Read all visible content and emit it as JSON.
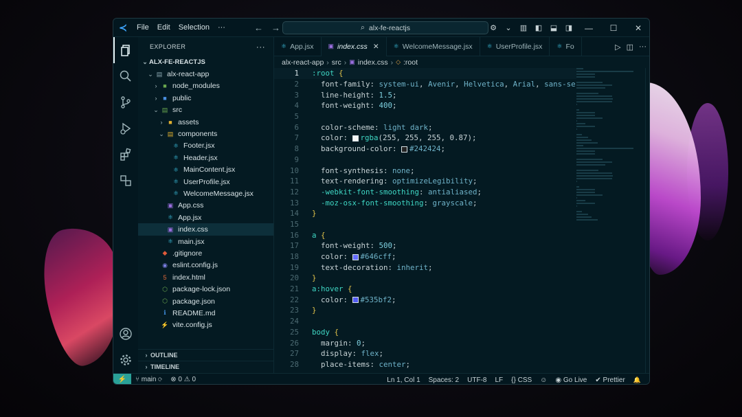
{
  "window": {
    "menu": [
      "File",
      "Edit",
      "Selection",
      "···"
    ],
    "search_text": "alx-fe-reactjs"
  },
  "sidebar": {
    "title": "EXPLORER",
    "more": "···",
    "workspace": "ALX-FE-REACTJS",
    "tree": [
      {
        "label": "alx-react-app",
        "depth": 1,
        "twisty": "open",
        "icon": "folder-open-icon",
        "icon_char": "▤",
        "color": "#8aa6b0"
      },
      {
        "label": "node_modules",
        "depth": 2,
        "twisty": "closed",
        "icon": "folder-node-icon",
        "icon_char": "■",
        "color": "#6aa84f"
      },
      {
        "label": "public",
        "depth": 2,
        "twisty": "closed",
        "icon": "folder-public-icon",
        "icon_char": "■",
        "color": "#4a8fe0"
      },
      {
        "label": "src",
        "depth": 2,
        "twisty": "open",
        "icon": "folder-src-icon",
        "icon_char": "▤",
        "color": "#6aa84f"
      },
      {
        "label": "assets",
        "depth": 3,
        "twisty": "closed",
        "icon": "folder-assets-icon",
        "icon_char": "■",
        "color": "#e0b030"
      },
      {
        "label": "components",
        "depth": 3,
        "twisty": "open",
        "icon": "folder-components-icon",
        "icon_char": "▤",
        "color": "#e0b030"
      },
      {
        "label": "Footer.jsx",
        "depth": 4,
        "twisty": "",
        "icon": "react-icon",
        "icon_char": "⚛",
        "color": "#3fc8e8"
      },
      {
        "label": "Header.jsx",
        "depth": 4,
        "twisty": "",
        "icon": "react-icon",
        "icon_char": "⚛",
        "color": "#3fc8e8"
      },
      {
        "label": "MainContent.jsx",
        "depth": 4,
        "twisty": "",
        "icon": "react-icon",
        "icon_char": "⚛",
        "color": "#3fc8e8"
      },
      {
        "label": "UserProfile.jsx",
        "depth": 4,
        "twisty": "",
        "icon": "react-icon",
        "icon_char": "⚛",
        "color": "#3fc8e8"
      },
      {
        "label": "WelcomeMessage.jsx",
        "depth": 4,
        "twisty": "",
        "icon": "react-icon",
        "icon_char": "⚛",
        "color": "#3fc8e8"
      },
      {
        "label": "App.css",
        "depth": 3,
        "twisty": "",
        "icon": "css-icon",
        "icon_char": "▣",
        "color": "#9b6fe0"
      },
      {
        "label": "App.jsx",
        "depth": 3,
        "twisty": "",
        "icon": "react-icon",
        "icon_char": "⚛",
        "color": "#3fc8e8"
      },
      {
        "label": "index.css",
        "depth": 3,
        "twisty": "",
        "icon": "css-icon",
        "icon_char": "▣",
        "color": "#9b6fe0",
        "selected": true
      },
      {
        "label": "main.jsx",
        "depth": 3,
        "twisty": "",
        "icon": "react-icon",
        "icon_char": "⚛",
        "color": "#3fc8e8"
      },
      {
        "label": ".gitignore",
        "depth": 2,
        "twisty": "",
        "icon": "git-icon",
        "icon_char": "◆",
        "color": "#e05a3a"
      },
      {
        "label": "eslint.config.js",
        "depth": 2,
        "twisty": "",
        "icon": "eslint-icon",
        "icon_char": "◉",
        "color": "#7a7ee0"
      },
      {
        "label": "index.html",
        "depth": 2,
        "twisty": "",
        "icon": "html-icon",
        "icon_char": "5",
        "color": "#e06a3a"
      },
      {
        "label": "package-lock.json",
        "depth": 2,
        "twisty": "",
        "icon": "nodejs-icon",
        "icon_char": "⬡",
        "color": "#6aa84f"
      },
      {
        "label": "package.json",
        "depth": 2,
        "twisty": "",
        "icon": "nodejs-icon",
        "icon_char": "⬡",
        "color": "#6aa84f"
      },
      {
        "label": "README.md",
        "depth": 2,
        "twisty": "",
        "icon": "info-icon",
        "icon_char": "ℹ",
        "color": "#3f8fe0"
      },
      {
        "label": "vite.config.js",
        "depth": 2,
        "twisty": "",
        "icon": "vite-icon",
        "icon_char": "⚡",
        "color": "#e0c030"
      }
    ],
    "outline": "OUTLINE",
    "timeline": "TIMELINE"
  },
  "tabs": [
    {
      "label": "App.jsx",
      "icon": "react-icon",
      "icon_char": "⚛",
      "color": "#3fc8e8"
    },
    {
      "label": "index.css",
      "icon": "css-icon",
      "icon_char": "▣",
      "color": "#9b6fe0",
      "active": true,
      "close": "✕"
    },
    {
      "label": "WelcomeMessage.jsx",
      "icon": "react-icon",
      "icon_char": "⚛",
      "color": "#3fc8e8"
    },
    {
      "label": "UserProfile.jsx",
      "icon": "react-icon",
      "icon_char": "⚛",
      "color": "#3fc8e8"
    },
    {
      "label": "Fo",
      "icon": "react-icon",
      "icon_char": "⚛",
      "color": "#3fc8e8"
    }
  ],
  "breadcrumb": [
    "alx-react-app",
    "src",
    "index.css",
    ":root"
  ],
  "editor": {
    "current_line": 1,
    "lines": [
      [
        {
          "t": ":root",
          "c": "sel"
        },
        {
          "t": " "
        },
        {
          "t": "{",
          "c": "br"
        }
      ],
      [
        {
          "t": "  font-family",
          "c": "prop"
        },
        {
          "t": ": "
        },
        {
          "t": "system-ui",
          "c": "val"
        },
        {
          "t": ", "
        },
        {
          "t": "Avenir",
          "c": "val"
        },
        {
          "t": ", "
        },
        {
          "t": "Helvetica",
          "c": "val"
        },
        {
          "t": ", "
        },
        {
          "t": "Arial",
          "c": "val"
        },
        {
          "t": ", "
        },
        {
          "t": "sans-se",
          "c": "val"
        }
      ],
      [
        {
          "t": "  line-height",
          "c": "prop"
        },
        {
          "t": ": "
        },
        {
          "t": "1.5",
          "c": "num"
        },
        {
          "t": ";"
        }
      ],
      [
        {
          "t": "  font-weight",
          "c": "prop"
        },
        {
          "t": ": "
        },
        {
          "t": "400",
          "c": "num"
        },
        {
          "t": ";"
        }
      ],
      [],
      [
        {
          "t": "  color-scheme",
          "c": "prop"
        },
        {
          "t": ": "
        },
        {
          "t": "light dark",
          "c": "val"
        },
        {
          "t": ";"
        }
      ],
      [
        {
          "t": "  color",
          "c": "prop"
        },
        {
          "t": ": "
        },
        {
          "sw": "#f5f5f5"
        },
        {
          "t": "rgba",
          "c": "fn"
        },
        {
          "t": "(255, 255, 255, 0.87);"
        }
      ],
      [
        {
          "t": "  background-color",
          "c": "prop"
        },
        {
          "t": ": "
        },
        {
          "sw": "#242424"
        },
        {
          "t": "#242424",
          "c": "val"
        },
        {
          "t": ";"
        }
      ],
      [],
      [
        {
          "t": "  font-synthesis",
          "c": "prop"
        },
        {
          "t": ": "
        },
        {
          "t": "none",
          "c": "val"
        },
        {
          "t": ";"
        }
      ],
      [
        {
          "t": "  text-rendering",
          "c": "prop"
        },
        {
          "t": ": "
        },
        {
          "t": "optimizeLegibility",
          "c": "val"
        },
        {
          "t": ";"
        }
      ],
      [
        {
          "t": "  -webkit-font-smoothing",
          "c": "vendor"
        },
        {
          "t": ": "
        },
        {
          "t": "antialiased",
          "c": "val"
        },
        {
          "t": ";"
        }
      ],
      [
        {
          "t": "  -moz-osx-font-smoothing",
          "c": "vendor"
        },
        {
          "t": ": "
        },
        {
          "t": "grayscale",
          "c": "val"
        },
        {
          "t": ";"
        }
      ],
      [
        {
          "t": "}",
          "c": "br"
        }
      ],
      [],
      [
        {
          "t": "a",
          "c": "sel"
        },
        {
          "t": " "
        },
        {
          "t": "{",
          "c": "br"
        }
      ],
      [
        {
          "t": "  font-weight",
          "c": "prop"
        },
        {
          "t": ": "
        },
        {
          "t": "500",
          "c": "num"
        },
        {
          "t": ";"
        }
      ],
      [
        {
          "t": "  color",
          "c": "prop"
        },
        {
          "t": ": "
        },
        {
          "sw": "#646cff"
        },
        {
          "t": "#646cff",
          "c": "val"
        },
        {
          "t": ";"
        }
      ],
      [
        {
          "t": "  text-decoration",
          "c": "prop"
        },
        {
          "t": ": "
        },
        {
          "t": "inherit",
          "c": "val"
        },
        {
          "t": ";"
        }
      ],
      [
        {
          "t": "}",
          "c": "br"
        }
      ],
      [
        {
          "t": "a:hover",
          "c": "sel"
        },
        {
          "t": " "
        },
        {
          "t": "{",
          "c": "br"
        }
      ],
      [
        {
          "t": "  color",
          "c": "prop"
        },
        {
          "t": ": "
        },
        {
          "sw": "#535bf2"
        },
        {
          "t": "#535bf2",
          "c": "val"
        },
        {
          "t": ";"
        }
      ],
      [
        {
          "t": "}",
          "c": "br"
        }
      ],
      [],
      [
        {
          "t": "body",
          "c": "sel"
        },
        {
          "t": " "
        },
        {
          "t": "{",
          "c": "br"
        }
      ],
      [
        {
          "t": "  margin",
          "c": "prop"
        },
        {
          "t": ": "
        },
        {
          "t": "0",
          "c": "num"
        },
        {
          "t": ";"
        }
      ],
      [
        {
          "t": "  display",
          "c": "prop"
        },
        {
          "t": ": "
        },
        {
          "t": "flex",
          "c": "val"
        },
        {
          "t": ";"
        }
      ],
      [
        {
          "t": "  place-items",
          "c": "prop"
        },
        {
          "t": ": "
        },
        {
          "t": "center",
          "c": "val"
        },
        {
          "t": ";"
        }
      ]
    ]
  },
  "status": {
    "remote_icon": "⚡",
    "branch": "main",
    "sync_icon": "⟳",
    "problems": "⊗ 0 ⚠ 0",
    "position": "Ln 1, Col 1",
    "spaces": "Spaces: 2",
    "encoding": "UTF-8",
    "eol": "LF",
    "language": "CSS",
    "language_icon": "{}",
    "copilot_icon": "☺",
    "golive": "Go Live",
    "golive_icon": "◉",
    "prettier": "Prettier",
    "prettier_icon": "✔",
    "bell_icon": "🔔"
  }
}
